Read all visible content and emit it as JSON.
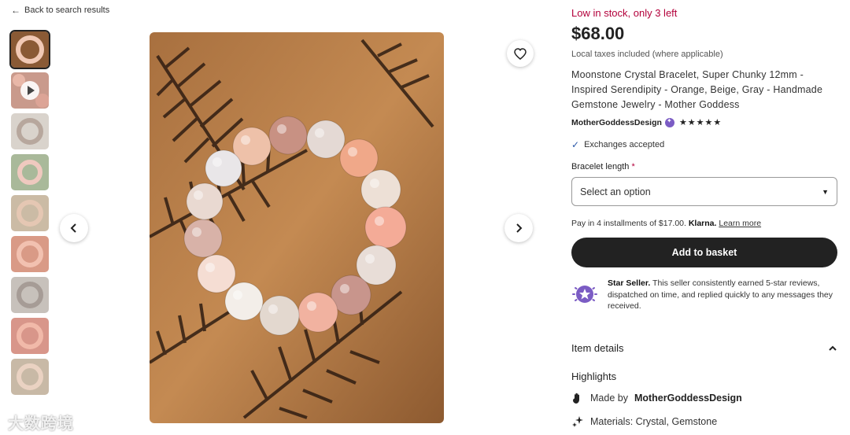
{
  "nav": {
    "back_label": "Back to search results"
  },
  "gallery": {
    "thumbnails": [
      {
        "kind": "image",
        "selected": true
      },
      {
        "kind": "video"
      },
      {
        "kind": "image"
      },
      {
        "kind": "image"
      },
      {
        "kind": "image"
      },
      {
        "kind": "image"
      },
      {
        "kind": "image"
      },
      {
        "kind": "image"
      },
      {
        "kind": "image"
      }
    ],
    "watermark": "大数跨境"
  },
  "listing": {
    "stock": "Low in stock, only 3 left",
    "price": "$68.00",
    "taxes": "Local taxes included (where applicable)",
    "title": "Moonstone Crystal Bracelet, Super Chunky 12mm - Inspired Serendipity - Orange, Beige, Gray - Handmade Gemstone Jewelry - Mother Goddess",
    "seller": "MotherGoddessDesign",
    "stars": "★★★★★",
    "exchanges": "Exchanges accepted",
    "option_label": "Bracelet length",
    "required_mark": "*",
    "select_placeholder": "Select an option",
    "klarna_text": "Pay in 4 installments of $17.00.",
    "klarna_brand": "Klarna.",
    "klarna_learn": "Learn more",
    "basket_label": "Add to basket",
    "star_seller_title": "Star Seller.",
    "star_seller_text": "This seller consistently earned 5-star reviews, dispatched on time, and replied quickly to any messages they received.",
    "item_details_label": "Item details",
    "highlights_label": "Highlights",
    "made_by_prefix": "Made by",
    "made_by_name": "MotherGoddessDesign",
    "materials": "Materials: Crystal, Gemstone"
  },
  "colors": {
    "stock_red": "#b3003b",
    "button_dark": "#222222",
    "star_seller_purple": "#7b5cc4",
    "check_blue": "#2b59a8"
  }
}
